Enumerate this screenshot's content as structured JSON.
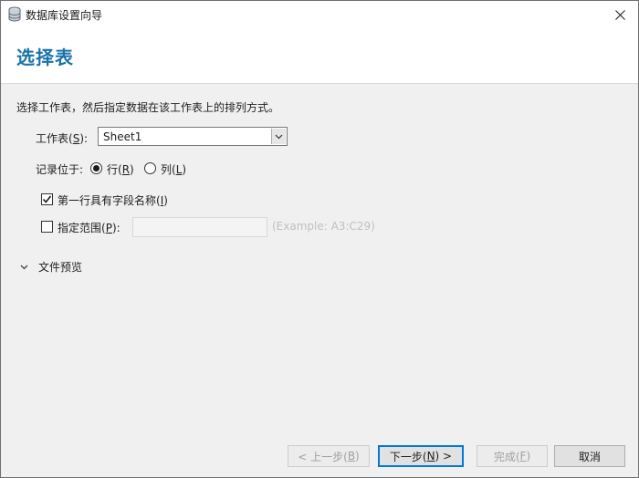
{
  "window": {
    "title": "数据库设置向导",
    "close_glyph": "✕"
  },
  "header": {
    "title": "选择表"
  },
  "main": {
    "instructions": "选择工作表，然后指定数据在该工作表上的排列方式。",
    "worksheet": {
      "label": "工作表(",
      "mnemonic": "S",
      "label_end": "):",
      "value": "Sheet1"
    },
    "records": {
      "label": "记录位于:",
      "row_label": "行(",
      "row_mnemonic": "R",
      "row_end": ")",
      "col_label": "列(",
      "col_mnemonic": "L",
      "col_end": ")",
      "selected": "row"
    },
    "first_row": {
      "label": "第一行具有字段名称(",
      "mnemonic": "I",
      "label_end": ")",
      "checked": true
    },
    "range": {
      "label": "指定范围(",
      "mnemonic": "P",
      "label_end": "):",
      "value": "",
      "hint": "(Example: A3:C29)",
      "checked": false
    },
    "preview": {
      "label": "文件预览",
      "expanded": false
    }
  },
  "footer": {
    "back": {
      "label": "< 上一步(",
      "mnemonic": "B",
      "label_end": ")",
      "enabled": false
    },
    "next": {
      "label": "下一步(",
      "mnemonic": "N",
      "label_end": ") >",
      "enabled": true
    },
    "finish": {
      "label": "完成(",
      "mnemonic": "F",
      "label_end": ")",
      "enabled": false
    },
    "cancel": {
      "label": "取消",
      "enabled": true
    }
  },
  "colors": {
    "title_accent": "#1a73a8",
    "default_button_border": "#0078d7",
    "window_bg": "#f0f0f0"
  },
  "icons": {
    "app": "database-icon",
    "close": "close-icon",
    "combo": "chevron-down-icon",
    "expander": "chevron-down-icon",
    "check": "checkmark-icon"
  }
}
